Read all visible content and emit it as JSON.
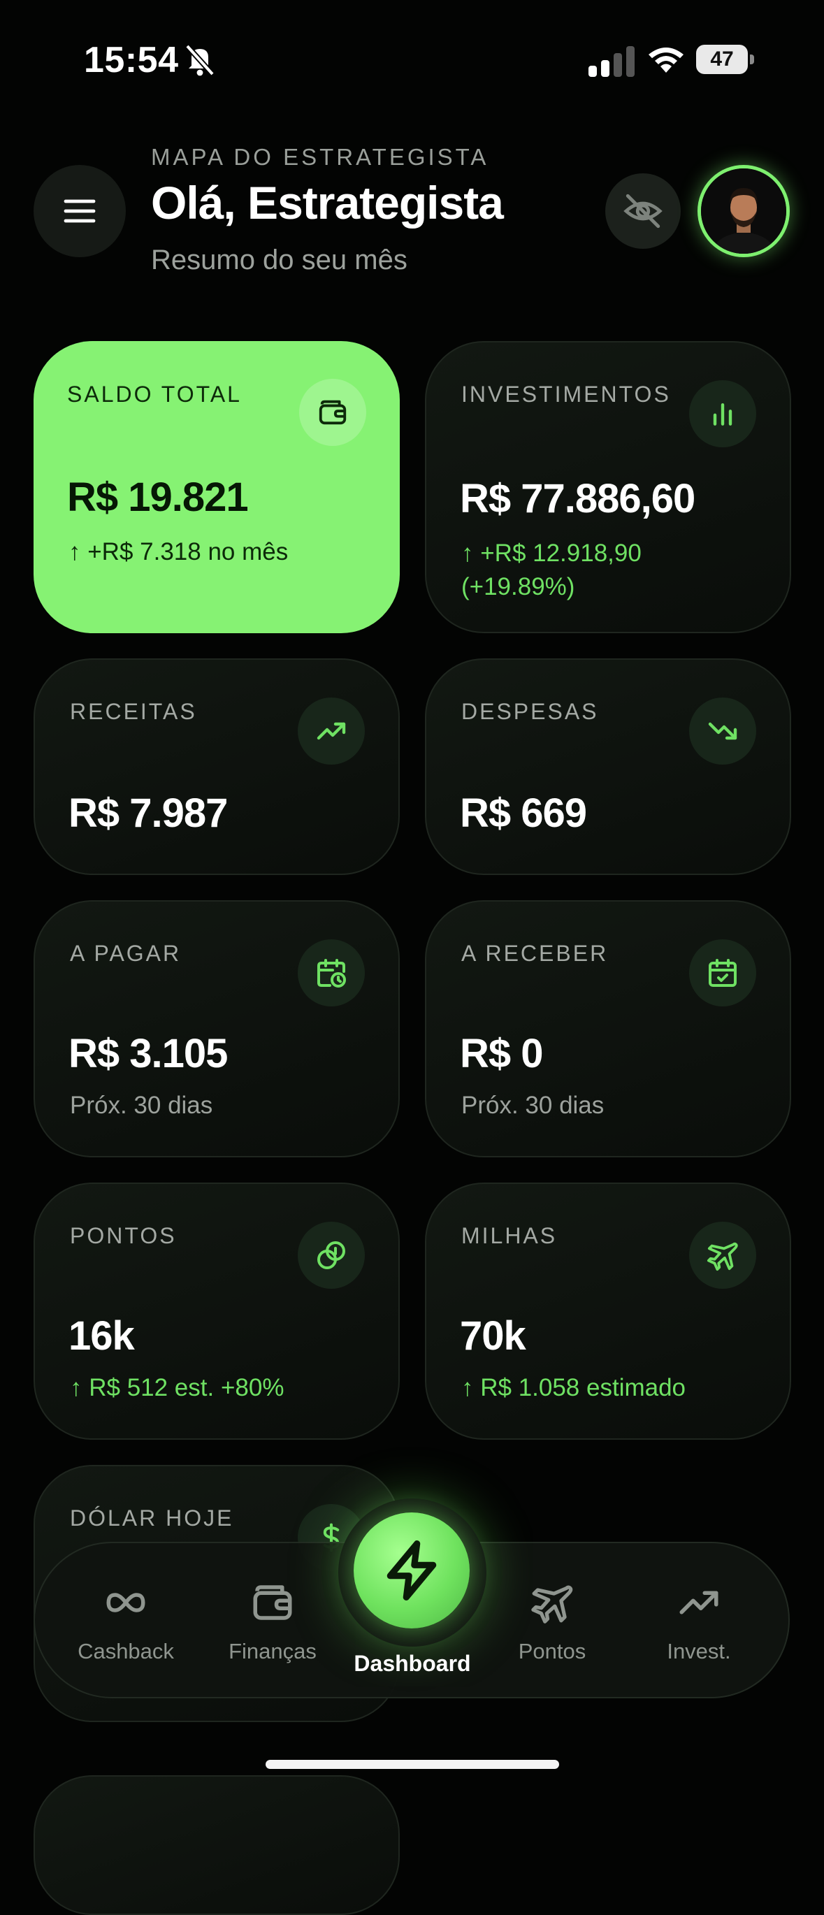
{
  "status_bar": {
    "time": "15:54",
    "battery": "47"
  },
  "header": {
    "eyebrow": "MAPA DO ESTRATEGISTA",
    "greeting": "Olá, Estrategista",
    "subtitle": "Resumo do seu mês"
  },
  "cards": {
    "saldo": {
      "label": "SALDO TOTAL",
      "value": "R$ 19.821",
      "sub": "↑ +R$ 7.318 no mês",
      "icon": "wallet-icon"
    },
    "investimentos": {
      "label": "INVESTIMENTOS",
      "value": "R$ 77.886,60",
      "sub1": "↑ +R$ 12.918,90",
      "sub2": "(+19.89%)",
      "icon": "bar-chart-icon"
    },
    "receitas": {
      "label": "RECEITAS",
      "value": "R$ 7.987",
      "icon": "trend-up-icon"
    },
    "despesas": {
      "label": "DESPESAS",
      "value": "R$ 669",
      "icon": "trend-down-icon"
    },
    "a_pagar": {
      "label": "A PAGAR",
      "value": "R$ 3.105",
      "sub": "Próx. 30 dias",
      "icon": "calendar-clock-icon"
    },
    "a_receber": {
      "label": "A RECEBER",
      "value": "R$ 0",
      "sub": "Próx. 30 dias",
      "icon": "calendar-check-icon"
    },
    "pontos": {
      "label": "PONTOS",
      "value": "16k",
      "sub": "↑ R$ 512 est. +80%",
      "icon": "coins-icon"
    },
    "milhas": {
      "label": "MILHAS",
      "value": "70k",
      "sub": "↑ R$ 1.058 estimado",
      "icon": "plane-icon"
    },
    "dolar": {
      "label": "DÓLAR HOJE",
      "icon": "dollar-icon"
    }
  },
  "nav": {
    "cashback": "Cashback",
    "financas": "Finanças",
    "dashboard": "Dashboard",
    "pontos": "Pontos",
    "invest": "Invest."
  },
  "colors": {
    "accent": "#86f273",
    "background": "#030403",
    "card": "#0f140f",
    "positive": "#6fe163"
  }
}
